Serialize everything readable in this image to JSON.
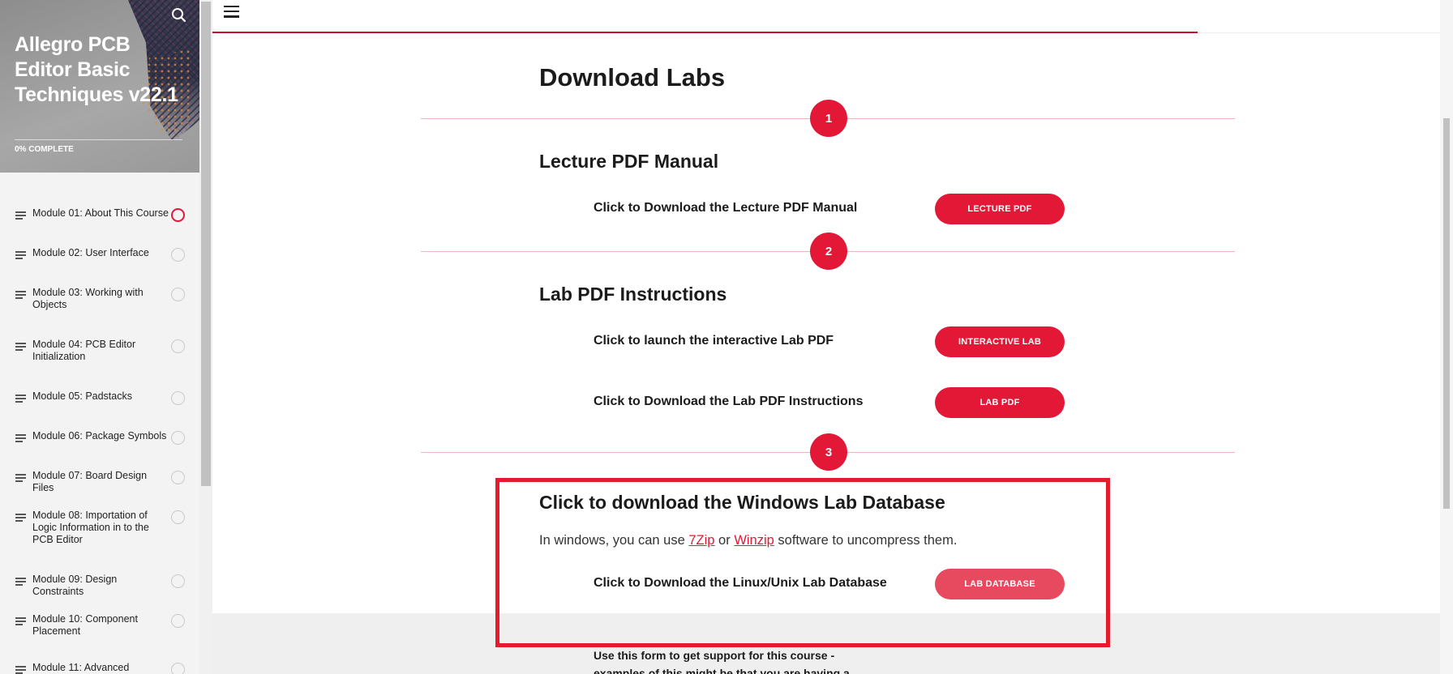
{
  "sidebar": {
    "course_title": "Allegro PCB Editor Basic Techniques v22.1",
    "progress_text": "0% COMPLETE",
    "modules": [
      {
        "label": "Module 01: About This Course",
        "status": "in-progress"
      },
      {
        "label": "Module 02: User Interface",
        "status": "not-started"
      },
      {
        "label": "Module 03: Working with Objects",
        "status": "not-started"
      },
      {
        "label": "Module 04: PCB Editor Initialization",
        "status": "not-started"
      },
      {
        "label": "Module 05: Padstacks",
        "status": "not-started"
      },
      {
        "label": "Module 06: Package Symbols",
        "status": "not-started"
      },
      {
        "label": "Module 07: Board Design Files",
        "status": "not-started"
      },
      {
        "label": "Module 08: Importation of Logic Information in to the PCB Editor",
        "status": "not-started"
      },
      {
        "label": "Module 09: Design Constraints",
        "status": "not-started"
      },
      {
        "label": "Module 10: Component Placement",
        "status": "not-started"
      },
      {
        "label": "Module 11: Advanced",
        "status": "not-started"
      }
    ]
  },
  "main": {
    "page_title": "Download Labs",
    "steps": [
      "1",
      "2",
      "3"
    ],
    "sections": {
      "lecture": {
        "heading": "Lecture PDF Manual",
        "row_label": "Click to Download the Lecture PDF Manual",
        "button": "LECTURE PDF"
      },
      "lab": {
        "heading": "Lab PDF Instructions",
        "row1_label": "Click to launch the interactive Lab PDF",
        "row1_button": "INTERACTIVE LAB",
        "row2_label": "Click to Download the Lab PDF Instructions",
        "row2_button": "LAB PDF"
      },
      "database": {
        "heading": "Click to download the Windows Lab Database",
        "para_prefix": "In windows, you can use ",
        "link1": "7Zip",
        "para_mid": " or ",
        "link2": "Winzip",
        "para_suffix": " software to uncompress them.",
        "row_label": "Click to Download the Linux/Unix Lab Database",
        "button": "LAB DATABASE"
      }
    },
    "support_text": "Use this form to get support for this course - examples of this might be that you are having a problem"
  },
  "colors": {
    "accent": "#e31837",
    "highlight_border": "#e31b2a"
  }
}
